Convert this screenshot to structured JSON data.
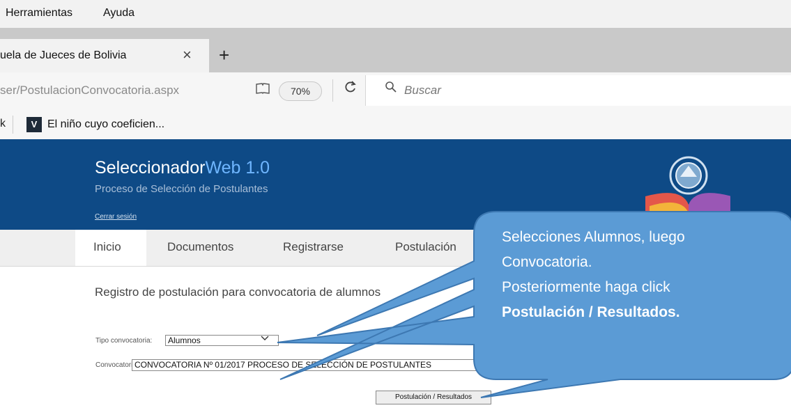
{
  "menubar": {
    "items": [
      "Herramientas",
      "Ayuda"
    ]
  },
  "tab": {
    "title": "uela de Jueces de Bolivia",
    "close_glyph": "×",
    "new_tab_glyph": "+"
  },
  "navbar": {
    "url": "ser/PostulacionConvocatoria.aspx",
    "zoom": "70%",
    "search_placeholder": "Buscar"
  },
  "bookmarks": {
    "partial_label": "k",
    "label": "El niño cuyo coeficien..."
  },
  "site": {
    "title_main": "Seleccionador",
    "title_accent": "Web 1.0",
    "subtitle": "Proceso de Selección de Postulantes",
    "logout": "Cerrar sesión",
    "nav": [
      "Inicio",
      "Documentos",
      "Registrarse",
      "Postulación"
    ],
    "heading": "Registro de postulación para convocatoria de alumnos",
    "form": {
      "tipo_label": "Tipo convocatoria:",
      "tipo_value": "Alumnos",
      "convocatoria_label": "Convocatoria:",
      "convocatoria_value": "CONVOCATORIA Nº 01/2017 PROCESO DE SELECCIÓN DE POSTULANTES",
      "submit_label": "Postulación / Resultados"
    }
  },
  "callout": {
    "line1": "Selecciones Alumnos, luego",
    "line2": "Convocatoria.",
    "line3": "Posteriormente haga click",
    "line4": "Postulación / Resultados."
  },
  "colors": {
    "header": "#0e4a86",
    "accent": "#6fb6ff",
    "callout": "#5b9bd5"
  }
}
